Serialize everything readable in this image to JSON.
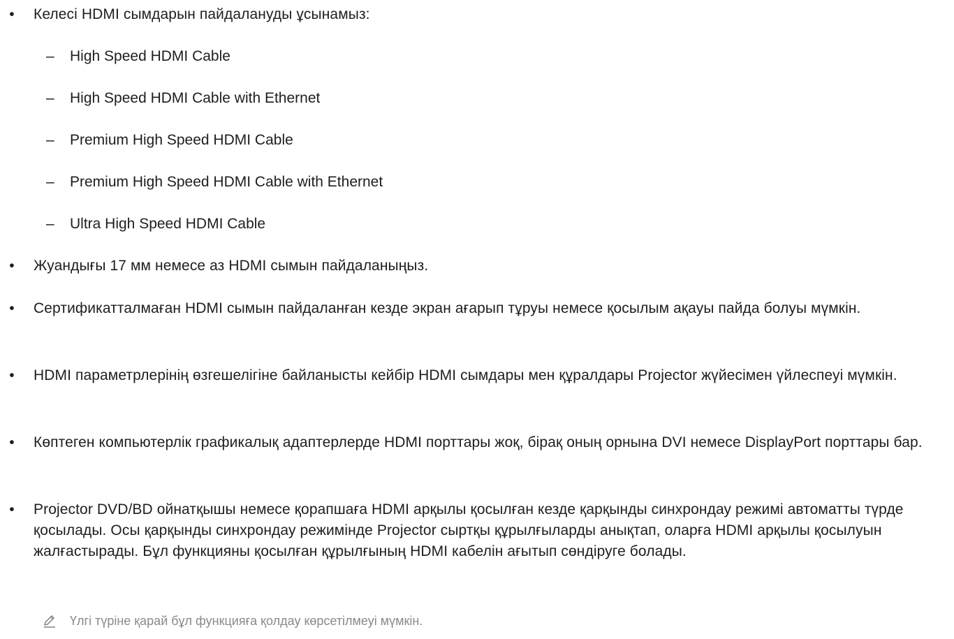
{
  "intro": "Келесі HDMI сымдарын пайдалануды ұсынамыз:",
  "cables": [
    "High Speed HDMI Cable",
    "High Speed HDMI Cable with Ethernet",
    "Premium High Speed HDMI Cable",
    "Premium High Speed HDMI Cable with Ethernet",
    "Ultra High Speed HDMI Cable"
  ],
  "bullets": [
    "Жуандығы 17 мм немесе аз HDMI сымын пайдаланыңыз.",
    "Сертификатталмаған HDMI сымын пайдаланған кезде экран ағарып тұруы немесе қосылым ақауы пайда болуы мүмкін.",
    "HDMI параметрлерінің өзгешелігіне байланысты кейбір HDMI сымдары мен құралдары Projector жүйесімен үйлеспеуі мүмкін.",
    "Көптеген компьютерлік графикалық адаптерлерде HDMI порттары жоқ, бірақ оның орнына DVI немесе DisplayPort порттары бар.",
    "Projector DVD/BD ойнатқышы немесе қорапшаға HDMI арқылы қосылған кезде қарқынды синхрондау режимі автоматты түрде қосылады. Осы қарқынды синхрондау режимінде Projector сыртқы құрылғыларды анықтап, оларға HDMI арқылы қосылуын жалғастырады. Бұл функцияны қосылған құрылғының HDMI кабелін ағытып сөндіруге болады."
  ],
  "note": "Үлгі түріне қарай бұл функцияға қолдау көрсетілмеуі мүмкін.",
  "icons": {
    "bullet": "•",
    "dash": "–",
    "note": "pencil-icon"
  }
}
